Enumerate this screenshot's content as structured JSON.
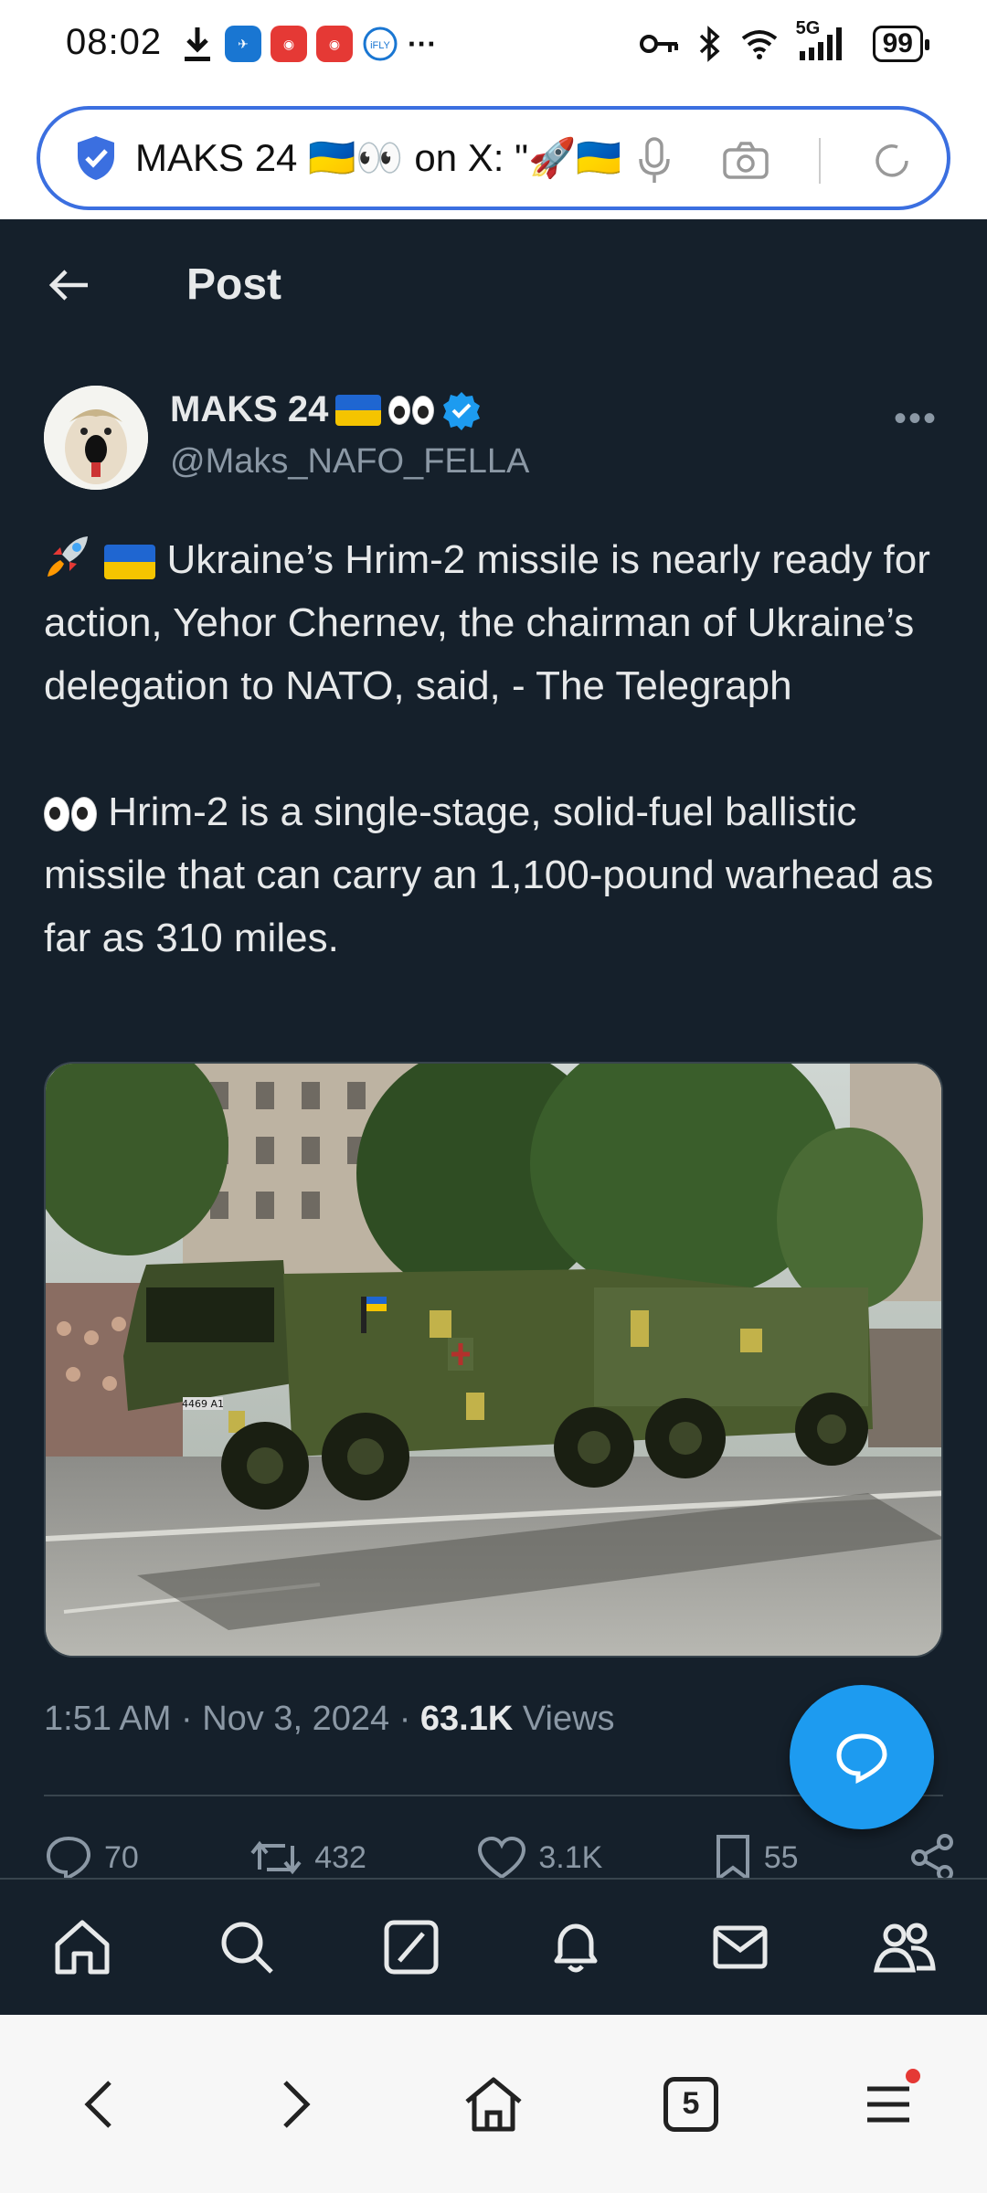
{
  "status_bar": {
    "time": "08:02",
    "network": "5G",
    "battery": "99"
  },
  "browser": {
    "address_text": "MAKS 24 🇺🇦👀 on X: \"🚀🇺🇦"
  },
  "header": {
    "title": "Post"
  },
  "author": {
    "name": "MAKS 24",
    "handle": "@Maks_NAFO_FELLA",
    "verified": true
  },
  "tweet": {
    "paragraph1": "Ukraine’s Hrim-2 missile is nearly ready for action, Yehor Chernev, the chairman of Ukraine’s delegation to NATO, said, - The Telegraph",
    "paragraph2": "Hrim-2 is a single-stage, solid-fuel ballistic missile that can carry an 1,100-pound warhead as far as 310 miles.",
    "image_plate": "4469 А1"
  },
  "meta": {
    "time": "1:51 AM",
    "date": "Nov 3, 2024",
    "views_count": "63.1K",
    "views_label": "Views",
    "separator": "·"
  },
  "actions": {
    "replies": "70",
    "reposts": "432",
    "likes": "3.1K",
    "bookmarks": "55"
  },
  "tab_count": "5",
  "colors": {
    "accent": "#1d9bf0",
    "background": "#15202b",
    "address_border": "#3b6fe0"
  }
}
